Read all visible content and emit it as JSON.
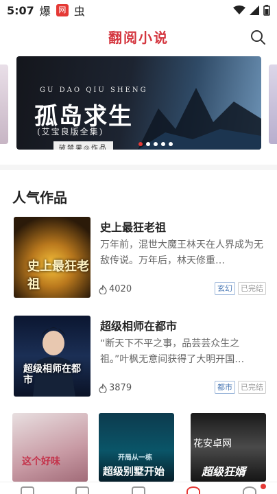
{
  "status_bar": {
    "time": "5:07",
    "icon1": "爆",
    "icon2": "网",
    "icon3": "虫"
  },
  "app": {
    "title": "翻阅小说"
  },
  "banner": {
    "pinyin": "GU DAO QIU SHENG",
    "title": "孤岛求生",
    "subtitle": "(艾宝良版全集)",
    "author": "破禁果◎作品",
    "dots": 5,
    "active_dot": 0
  },
  "section": {
    "title": "人气作品"
  },
  "books": [
    {
      "title": "史上最狂老祖",
      "desc": "万年前，混世大魔王林天在人界成为无敌传说。万年后，林天修重…",
      "count": "4020",
      "tags": [
        "玄幻",
        "已完结"
      ],
      "cover_text": "史上最狂老祖"
    },
    {
      "title": "超级相师在都市",
      "desc": "“断天下不平之事，品芸芸众生之祖。”叶枫无意间获得了大明开国…",
      "count": "3879",
      "tags": [
        "都市",
        "已完结"
      ],
      "cover_text": "超级相师在都市"
    }
  ],
  "grid": [
    {
      "cover_text": "这个好味"
    },
    {
      "cover_text_top": "开局从一栋",
      "cover_text": "超级别墅开始"
    },
    {
      "cover_text_top": "花安卓网",
      "cover_text": "超级狂婿"
    }
  ],
  "colors": {
    "accent": "#d4363f",
    "tag_blue": "#4a78b5",
    "divider": "#f5f5f5"
  }
}
